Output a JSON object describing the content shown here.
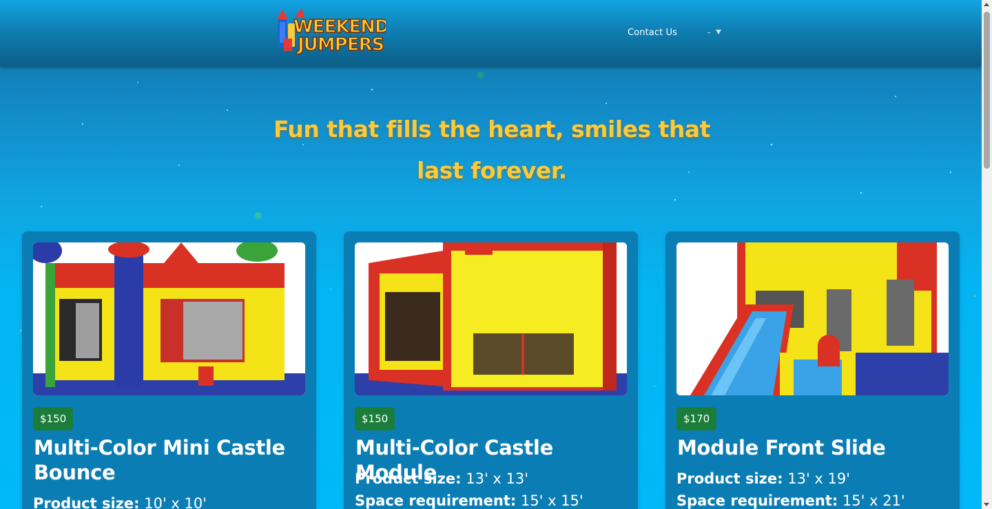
{
  "header": {
    "logo_alt": "Weekend Jumpers",
    "logo_line1": "WEEKEND",
    "logo_line2": "JUMPERS",
    "nav": {
      "contact_label": "Contact Us",
      "dropdown_label": "-"
    }
  },
  "hero": {
    "tagline": "Fun that fills the heart, smiles that last forever."
  },
  "products": [
    {
      "price": "$150",
      "title": "Multi-Color Mini Castle Bounce",
      "size_label": "Product size:",
      "size_value": "10' x 10'"
    },
    {
      "price": "$150",
      "title": "Multi-Color Castle Module",
      "size_label": "Product size:",
      "size_value": "13' x 13'",
      "space_label": "Space requirement:",
      "space_value": "15' x 15'"
    },
    {
      "price": "$170",
      "title": "Module Front Slide",
      "size_label": "Product size:",
      "size_value": "13' x 19'",
      "space_label": "Space requirement:",
      "space_value": "15' x 21'"
    }
  ],
  "colors": {
    "nav_top": "#12a5e3",
    "nav_bottom": "#0b5f88",
    "tagline": "#fbc93a",
    "card_bg": "#0a7db4",
    "price_badge": "#1b7d3a"
  }
}
